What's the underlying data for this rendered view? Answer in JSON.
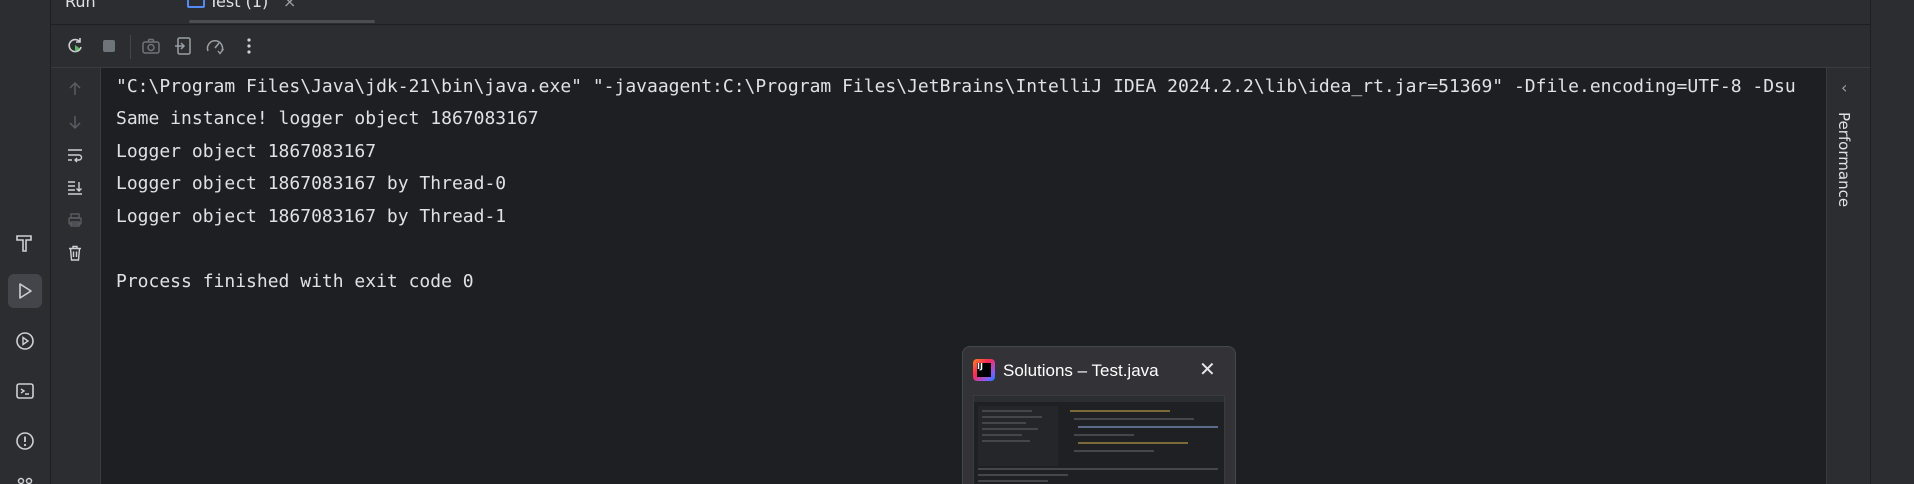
{
  "tabbar": {
    "run_label": "Run",
    "tab_label": "Test (1)",
    "tab_close": "×"
  },
  "console": {
    "lines": [
      "\"C:\\Program Files\\Java\\jdk-21\\bin\\java.exe\" \"-javaagent:C:\\Program Files\\JetBrains\\IntelliJ IDEA 2024.2.2\\lib\\idea_rt.jar=51369\" -Dfile.encoding=UTF-8 -Dsu",
      "Same instance! logger object 1867083167",
      "Logger object 1867083167",
      "Logger object 1867083167 by Thread-0",
      "Logger object 1867083167 by Thread-1",
      "",
      "Process finished with exit code 0"
    ]
  },
  "right_panel": {
    "label": "Performance",
    "chevron": "‹"
  },
  "thumbnail": {
    "title": "Solutions – Test.java",
    "close": "✕",
    "icon_text": "IJ"
  },
  "colors": {
    "background": "#1e1f22",
    "panel": "#2b2d30",
    "accent": "#548af7",
    "run_green": "#5fb865"
  },
  "icons": {
    "left_strip": [
      "hammer-icon",
      "run-icon",
      "services-icon",
      "terminal-icon",
      "problems-icon",
      "git-icon"
    ],
    "toolbar": [
      "rerun-icon",
      "stop-icon",
      "camera-icon",
      "restore-layout-icon",
      "profiler-icon",
      "more-icon"
    ],
    "gutter": [
      "up-arrow-icon",
      "down-arrow-icon",
      "soft-wrap-icon",
      "scroll-to-end-icon",
      "print-icon",
      "trash-icon"
    ]
  }
}
